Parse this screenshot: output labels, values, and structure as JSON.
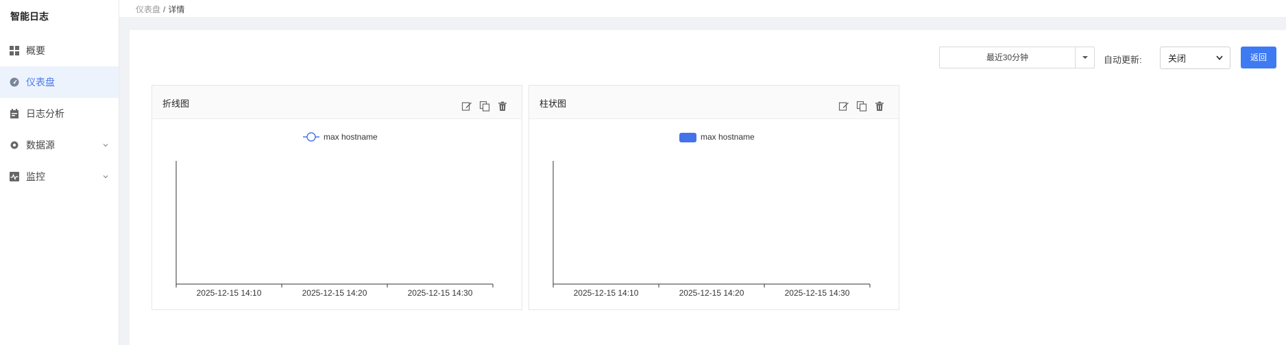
{
  "app": {
    "title": "智能日志"
  },
  "sidebar": {
    "items": [
      {
        "label": "概要",
        "icon": "grid-icon",
        "active": false,
        "expandable": false
      },
      {
        "label": "仪表盘",
        "icon": "dashboard-gauge-icon",
        "active": true,
        "expandable": false
      },
      {
        "label": "日志分析",
        "icon": "calendar-log-icon",
        "active": false,
        "expandable": false
      },
      {
        "label": "数据源",
        "icon": "gear-icon",
        "active": false,
        "expandable": true
      },
      {
        "label": "监控",
        "icon": "monitor-pulse-icon",
        "active": false,
        "expandable": true
      }
    ]
  },
  "breadcrumb": {
    "parent": "仪表盘",
    "separator": "/",
    "current": "详情"
  },
  "toolbar": {
    "time_range": "最近30分钟",
    "auto_refresh_label": "自动更新:",
    "auto_refresh_value": "关闭",
    "back_label": "返回"
  },
  "colors": {
    "accent": "#3e7bf3",
    "nav_active_bg": "#edf3fd",
    "series": "#4472e8"
  },
  "panels": [
    {
      "title": "折线图",
      "tools": [
        "edit-icon",
        "copy-icon",
        "delete-icon"
      ],
      "chart_data": {
        "type": "line",
        "legend": [
          "max hostname"
        ],
        "x_ticks": [
          "2025-12-15 14:10",
          "2025-12-15 14:20",
          "2025-12-15 14:30"
        ],
        "series": [
          {
            "name": "max hostname",
            "values": []
          }
        ]
      }
    },
    {
      "title": "柱状图",
      "tools": [
        "edit-icon",
        "copy-icon",
        "delete-icon"
      ],
      "chart_data": {
        "type": "bar",
        "legend": [
          "max hostname"
        ],
        "x_ticks": [
          "2025-12-15 14:10",
          "2025-12-15 14:20",
          "2025-12-15 14:30"
        ],
        "series": [
          {
            "name": "max hostname",
            "values": []
          }
        ]
      }
    }
  ]
}
